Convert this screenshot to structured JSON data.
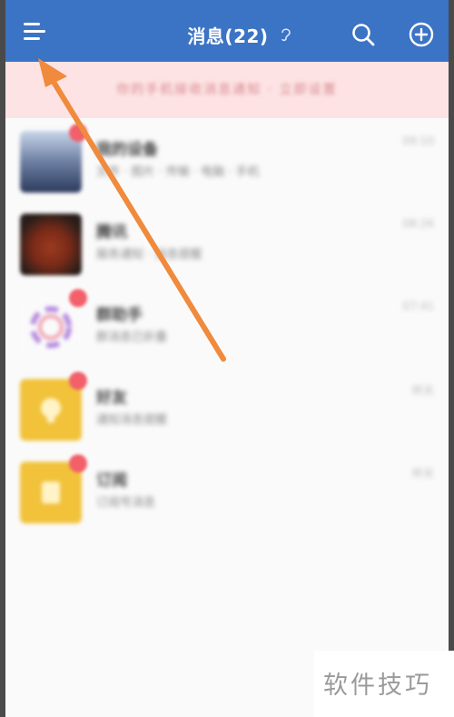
{
  "header": {
    "title": "消息(22)",
    "icons": [
      "menu-icon",
      "ear-icon",
      "search-icon",
      "plus-icon"
    ]
  },
  "banner": {
    "text": "你的手机接收消息通知 · 立即设置"
  },
  "conversations": [
    {
      "name": "我的设备",
      "preview": "文件 · 图片 · 传输 · 电脑 · 手机",
      "time": "09:10",
      "has_badge": true
    },
    {
      "name": "腾讯",
      "preview": "服务通知 · 消息提醒",
      "time": "08:26",
      "has_badge": false
    },
    {
      "name": "群助手",
      "preview": "群消息已折叠",
      "time": "07:41",
      "has_badge": true
    },
    {
      "name": "好友",
      "preview": "通知消息提醒",
      "time": "昨天",
      "has_badge": true
    },
    {
      "name": "订阅",
      "preview": "订阅号消息",
      "time": "昨天",
      "has_badge": true
    }
  ],
  "watermark": "软件技巧",
  "colors": {
    "header": "#3b73c5",
    "banner": "#fde3e4",
    "badge": "#f2606a",
    "arrow": "#f08a3c"
  }
}
